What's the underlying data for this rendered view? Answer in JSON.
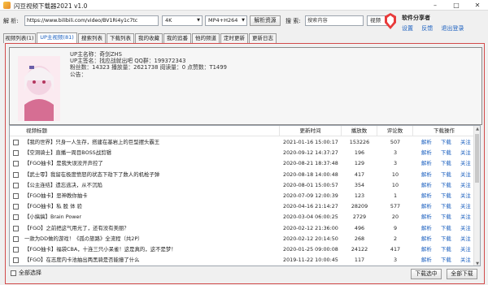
{
  "window": {
    "title": "闪豆视频下载器2021 v1.0"
  },
  "toolbar": {
    "url_label": "解 析:",
    "url_value": "https://www.bilibili.com/video/BV1Ri4y1c7tc",
    "quality": "4K",
    "format": "MP4+H264",
    "parse_button": "解析资源",
    "search_label": "搜 索:",
    "search_placeholder": "搜索内容",
    "search_type": "视频",
    "search_button": "搜索资源"
  },
  "brand": {
    "name": "软件分享者",
    "links": [
      "设置",
      "反馈",
      "退出登录"
    ]
  },
  "tabs": [
    "视频列表(1)",
    "UP主视频(81)",
    "搜索列表",
    "下载列表",
    "我的收藏",
    "我的追番",
    "他的频道",
    "定时更新",
    "更新日志"
  ],
  "active_tab": 1,
  "up_info": {
    "line1": "UP主名称：奇剑ZHS",
    "line2": "UP主签名：找应战就出吧 QQ群：199372343",
    "line3": "粉丝数：14323   播放量：2621738   阅读量：0   点赞数：T1499",
    "line4": "公告："
  },
  "table": {
    "headers": [
      "视频标题",
      "更新时间",
      "播放数",
      "评论数",
      "下载操作"
    ],
    "op_labels": [
      "解析",
      "下载",
      "关注"
    ],
    "rows": [
      {
        "title": "【我的世界】只身一人生存，搭建在基岩上的巨型摆头霸王",
        "time": "2021-01-16 15:00:17",
        "plays": "153226",
        "comments": "507"
      },
      {
        "title": "【空洞骑士】直播一周目BOSS战剪辑",
        "time": "2020-09-12 14:37:27",
        "plays": "196",
        "comments": "3"
      },
      {
        "title": "【FGO抽卡】是我失误没开声控了",
        "time": "2020-08-21 18:37:48",
        "plays": "129",
        "comments": "3"
      },
      {
        "title": "【武士零】我留在极度愤怒的状态下劫下了数人的机枪子弹",
        "time": "2020-08-18 14:00:48",
        "plays": "417",
        "comments": "10"
      },
      {
        "title": "【公主连结】遗忘逃决，从不沉陷",
        "time": "2020-08-01 15:00:57",
        "plays": "354",
        "comments": "10"
      },
      {
        "title": "【FGO抽卡】恶神教你抽卡",
        "time": "2020-07-09 12:00:39",
        "plays": "123",
        "comments": "1"
      },
      {
        "title": "【FGO抽卡】私 股 体 验",
        "time": "2020-04-16 21:14:27",
        "plays": "28209",
        "comments": "577"
      },
      {
        "title": "【小搞搞】Brain Power",
        "time": "2020-03-04 06:00:25",
        "plays": "2729",
        "comments": "20"
      },
      {
        "title": "【FGO】之前把这气用光了，还有没有美丽？",
        "time": "2020-02-12 21:36:00",
        "plays": "496",
        "comments": "9"
      },
      {
        "title": "一款为DD做的游戏！《孤の旅路》全流程（共2P）",
        "time": "2020-02-12 20:14:50",
        "plays": "268",
        "comments": "2"
      },
      {
        "title": "【FGO抽卡】福袋CBA，十连三只小呆雀！这是真的，这不是梦！",
        "time": "2020-01-25 09:00:08",
        "plays": "24122",
        "comments": "417"
      },
      {
        "title": "【FGO】在志度内卡池抽出两黑骑是否能撞了什么",
        "time": "2019-11-22 10:00:45",
        "plays": "117",
        "comments": "3"
      }
    ]
  },
  "footer": {
    "select_all": "全部选择",
    "download_selected": "下载选中",
    "download_all": "全部下载"
  },
  "colors": {
    "accent": "#1a5fbf",
    "panel_border": "#d24b4b"
  }
}
